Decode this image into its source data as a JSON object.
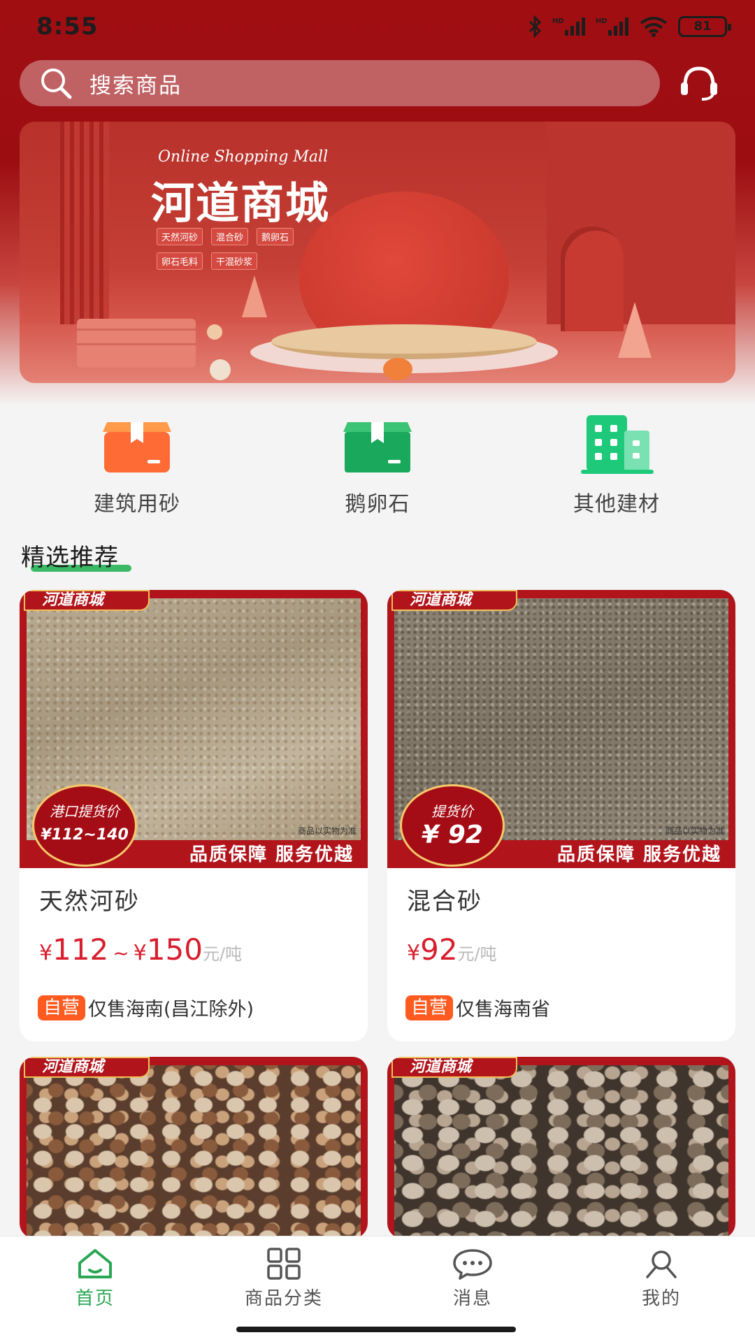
{
  "status_bar": {
    "time": "8:55",
    "battery": "81"
  },
  "search": {
    "placeholder": "搜索商品"
  },
  "banner": {
    "subtitle": "Online Shopping Mall",
    "title": "河道商城",
    "tags": [
      "天然河砂",
      "混合砂",
      "鹅卵石",
      "卵石毛料",
      "干混砂浆"
    ]
  },
  "categories": [
    {
      "label": "建筑用砂",
      "icon": "box-icon",
      "color": "#ff6b35"
    },
    {
      "label": "鹅卵石",
      "icon": "box-icon",
      "color": "#1aa85c"
    },
    {
      "label": "其他建材",
      "icon": "building-icon",
      "color": "#1ec97a"
    }
  ],
  "section": {
    "title": "精选推荐"
  },
  "products": [
    {
      "brand": "河道商城",
      "badge_label": "港口提货价",
      "badge_value": "¥112~140",
      "slogan": "品质保障 服务优越",
      "watermark": "商品以实物为准",
      "name": "天然河砂",
      "yen1": "¥",
      "price_low": "112",
      "tilde": "~",
      "yen2": "¥",
      "price_high": "150",
      "unit": "元/吨",
      "self_badge": "自营",
      "area": "仅售海南(昌江除外)"
    },
    {
      "brand": "河道商城",
      "badge_label": "提货价",
      "badge_value": "¥ 92",
      "slogan": "品质保障 服务优越",
      "watermark": "商品以实物为准",
      "name": "混合砂",
      "yen1": "¥",
      "price_low": "92",
      "unit": "元/吨",
      "self_badge": "自营",
      "area": "仅售海南省"
    },
    {
      "brand": "河道商城"
    },
    {
      "brand": "河道商城"
    }
  ],
  "bottom_nav": [
    {
      "label": "首页",
      "icon": "home-icon",
      "active": true
    },
    {
      "label": "商品分类",
      "icon": "grid-icon",
      "active": false
    },
    {
      "label": "消息",
      "icon": "chat-icon",
      "active": false
    },
    {
      "label": "我的",
      "icon": "user-icon",
      "active": false
    }
  ],
  "colors": {
    "header_red": "#9c0d12",
    "accent_green": "#2aa655",
    "price_red": "#d81e2d",
    "self_orange": "#ff5a1f"
  }
}
